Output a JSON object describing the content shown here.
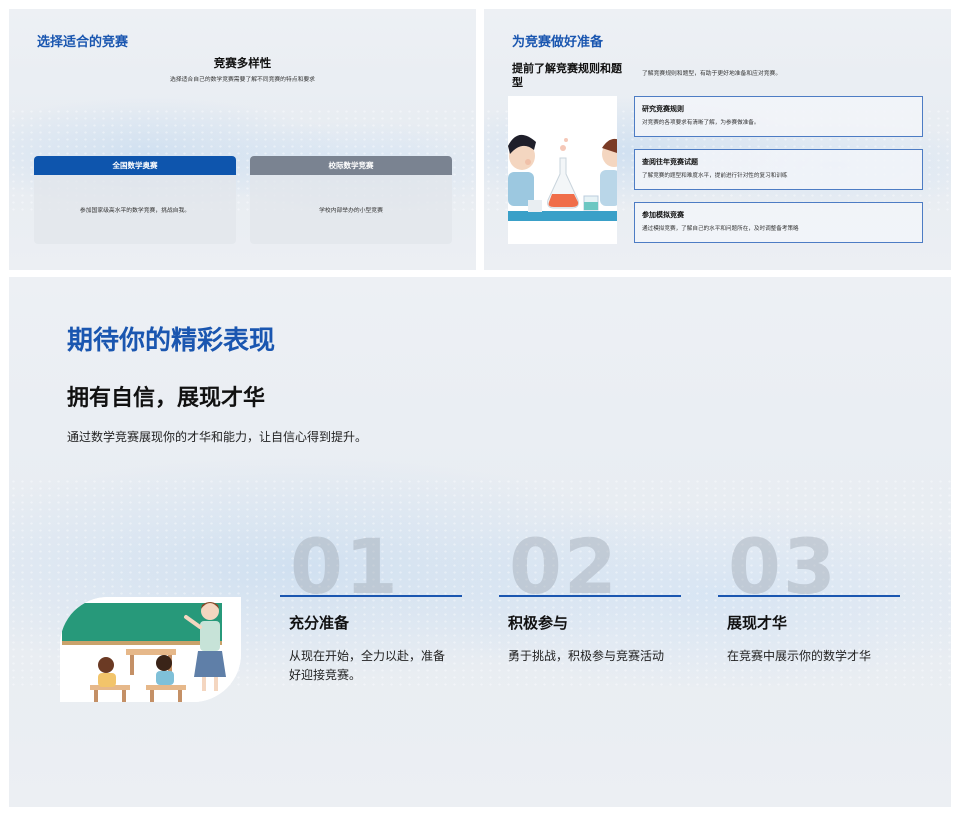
{
  "slide1": {
    "title": "选择适合的竞赛",
    "subtitle": "竞赛多样性",
    "description": "选择适合自己的数学竞赛需要了解不同竞赛的特点和要求",
    "cards": [
      {
        "header": "全国数学奥赛",
        "body": "参加国家级高水平的数学竞赛，挑战自我。",
        "color": "#0e55ad"
      },
      {
        "header": "校际数学竞赛",
        "body": "学校内部举办的小型竞赛",
        "color": "#7a8391"
      }
    ]
  },
  "slide2": {
    "title": "为竞赛做好准备",
    "subtitle": "提前了解竞赛规则和题型",
    "lead": "了解竞赛规则和题型，有助于更好地准备和应对竞赛。",
    "steps": [
      {
        "title": "研究竞赛规则",
        "desc": "对竞赛的各项要求有清晰了解，为参赛做准备。"
      },
      {
        "title": "查阅往年竞赛试题",
        "desc": "了解竞赛的题型和难度水平，提前进行针对性的复习和训练"
      },
      {
        "title": "参加模拟竞赛",
        "desc": "通过模拟竞赛，了解自己的水平和问题所在，及时调整备考策略"
      }
    ]
  },
  "slide3": {
    "title": "期待你的精彩表现",
    "subtitle": "拥有自信，展现才华",
    "description": "通过数学竞赛展现你的才华和能力，让自信心得到提升。",
    "columns": [
      {
        "num": "01",
        "head": "充分准备",
        "text": "从现在开始，全力以赴，准备好迎接竞赛。"
      },
      {
        "num": "02",
        "head": "积极参与",
        "text": "勇于挑战，积极参与竞赛活动"
      },
      {
        "num": "03",
        "head": "展现才华",
        "text": "在竞赛中展示你的数学才华"
      }
    ]
  },
  "colors": {
    "accent": "#1a56b0",
    "card_blue": "#0e55ad",
    "card_gray": "#7a8391"
  }
}
